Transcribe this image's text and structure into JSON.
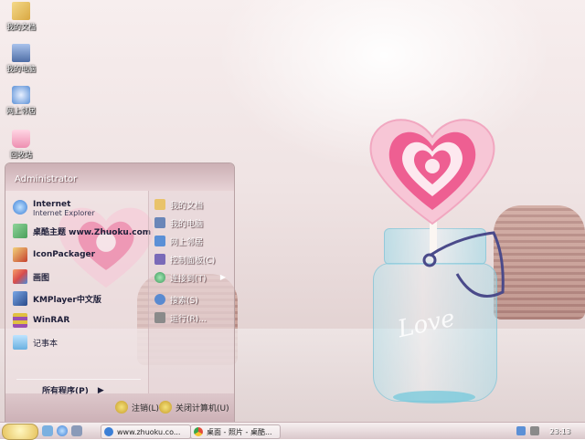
{
  "desktop": {
    "icons": [
      {
        "label": "我的文档",
        "icon": "folder-documents-icon",
        "color": "#e9c36a"
      },
      {
        "label": "我的电脑",
        "icon": "computer-icon",
        "color": "#6a86b8"
      },
      {
        "label": "网上邻居",
        "icon": "network-icon",
        "color": "#5b90d6"
      },
      {
        "label": "回收站",
        "icon": "recycle-bin-icon",
        "color": "#f2a6c0"
      }
    ],
    "wallpaper_text": "Love"
  },
  "start_menu": {
    "user": "Administrator",
    "pinned": [
      {
        "title": "Internet",
        "subtitle": "Internet Explorer",
        "icon": "internet-explorer-icon",
        "color": "#3b7fd6"
      },
      {
        "title": "桌酷主题 www.Zhuoku.com",
        "subtitle": "",
        "icon": "zhuoku-theme-icon",
        "color": "#4a9f5a"
      }
    ],
    "recent": [
      {
        "title": "IconPackager",
        "icon": "iconpackager-icon",
        "color": "#d8a43a"
      },
      {
        "title": "画图",
        "icon": "paint-icon",
        "color": "#e0703a"
      },
      {
        "title": "KMPlayer中文版",
        "icon": "kmplayer-icon",
        "color": "#3a5fa8"
      },
      {
        "title": "WinRAR",
        "icon": "winrar-icon",
        "color": "#9a4fb0"
      },
      {
        "title": "记事本",
        "icon": "notepad-icon",
        "color": "#6ab0e0"
      }
    ],
    "all_programs": "所有程序(P)",
    "right": [
      {
        "label": "我的文档",
        "icon": "my-documents-icon",
        "color": "#e9c36a",
        "arrow": false
      },
      {
        "label": "我的电脑",
        "icon": "my-computer-icon",
        "color": "#6a86b8",
        "arrow": false
      },
      {
        "label": "网上邻居",
        "icon": "network-places-icon",
        "color": "#5b90d6",
        "arrow": false
      },
      {
        "label": "控制面板(C)",
        "icon": "control-panel-icon",
        "color": "#7a6ab8",
        "arrow": false
      },
      {
        "label": "连接到(T)",
        "icon": "connect-to-icon",
        "color": "#3a9a5a",
        "arrow": true
      },
      {
        "label": "搜索(S)",
        "icon": "search-icon",
        "color": "#5a8ad0",
        "arrow": false
      },
      {
        "label": "运行(R)...",
        "icon": "run-icon",
        "color": "#8a8a8a",
        "arrow": false
      }
    ],
    "logoff": "注销(L)",
    "shutdown": "关闭计算机(U)"
  },
  "taskbar": {
    "tasks": [
      {
        "label": "www.zhuoku.co...",
        "icon": "ie-task-icon",
        "color": "#3b7fd6"
      },
      {
        "label": "桌面 - 照片 - 桌酷...",
        "icon": "chrome-task-icon",
        "color": "#e24b3a"
      }
    ],
    "clock": "23:13"
  },
  "colors": {
    "accent": "#e85a8a",
    "taskbar": "#e9dcde"
  }
}
